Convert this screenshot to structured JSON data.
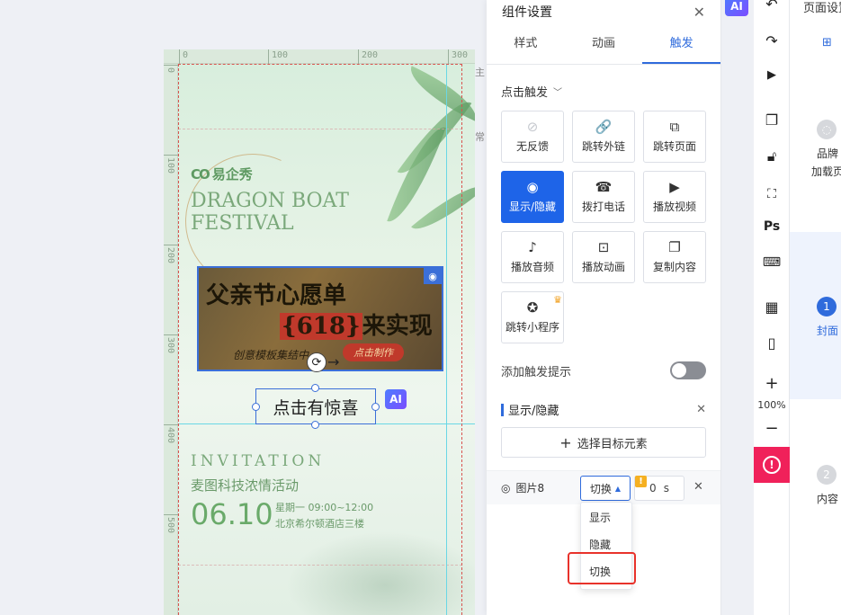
{
  "canvas": {
    "ruler_h": [
      "0",
      "100",
      "200",
      "300"
    ],
    "ruler_v": [
      "0",
      "100",
      "200",
      "300",
      "400",
      "500"
    ],
    "side_labels": [
      "主",
      "常"
    ],
    "logo": {
      "mark": "CO",
      "text": "易企秀"
    },
    "festival_title": "DRAGON BOAT FESTIVAL",
    "banner": {
      "line1": "父亲节心愿单",
      "line2_num": "{618}",
      "line2_text": "来实现",
      "sub": "创意模板集结中",
      "button": "点击制作"
    },
    "selected_text": "点击有惊喜",
    "ai_badge": "AI",
    "invitation": "INVITATION",
    "event_name": "麦图科技浓情活动",
    "event_date": "06.10",
    "event_time": "星期一  09:00~12:00",
    "event_place": "北京希尔顿酒店三楼"
  },
  "settings": {
    "title": "组件设置",
    "tabs": [
      "样式",
      "动画",
      "触发"
    ],
    "active_tab": "触发",
    "trigger_type": "点击触发",
    "actions": [
      {
        "label": "无反馈",
        "icon": "⊘"
      },
      {
        "label": "跳转外链",
        "icon": "🔗"
      },
      {
        "label": "跳转页面",
        "icon": "⧉"
      },
      {
        "label": "显示/隐藏",
        "icon": "◉"
      },
      {
        "label": "拨打电话",
        "icon": "☎"
      },
      {
        "label": "播放视频",
        "icon": "▶"
      },
      {
        "label": "播放音频",
        "icon": "♪"
      },
      {
        "label": "播放动画",
        "icon": "⊡"
      },
      {
        "label": "复制内容",
        "icon": "❐"
      },
      {
        "label": "跳转小程序",
        "icon": "✪"
      }
    ],
    "active_action": "显示/隐藏",
    "add_hint_label": "添加触发提示",
    "add_hint_on": false,
    "section_title": "显示/隐藏",
    "select_target_label": "选择目标元素",
    "target": {
      "name": "图片8",
      "mode": "切换",
      "delay_value": "0",
      "delay_unit": "s",
      "warn": "!"
    },
    "mode_options": [
      "显示",
      "隐藏",
      "切换"
    ],
    "highlighted_option": "切换"
  },
  "toolbar": {
    "ai_label": "AI",
    "tools": [
      "undo-icon",
      "redo-icon",
      "play-icon",
      "pages-icon",
      "lock-icon",
      "scan-text-icon",
      "ps-icon",
      "keyboard-icon",
      "grid-icon",
      "mobile-icon",
      "zoom-in-icon",
      "zoom-out-icon"
    ],
    "ps_label": "Ps",
    "zoom": "100%",
    "alert_symbol": "!"
  },
  "page_panel": {
    "title": "页面设置",
    "items": [
      {
        "num": "",
        "label": "品牌",
        "label2": "加载页"
      },
      {
        "num": "1",
        "label": "封面"
      },
      {
        "num": "2",
        "label": "内容"
      }
    ]
  },
  "colors": {
    "accent": "#1e64e8",
    "alert": "#f0215a",
    "highlight_box": "#e8322b"
  }
}
